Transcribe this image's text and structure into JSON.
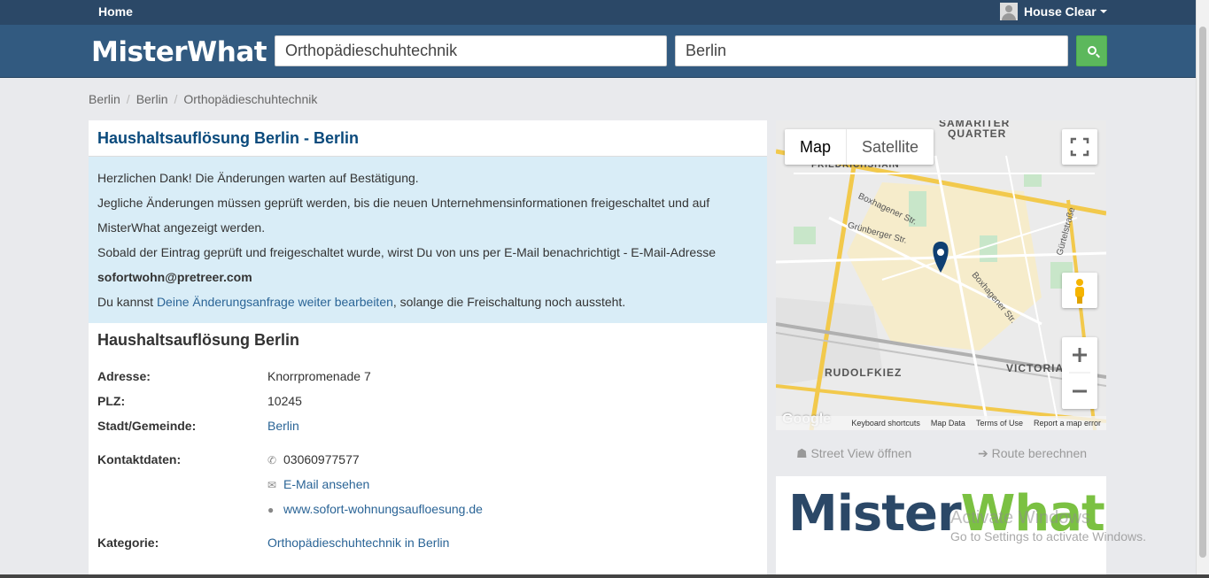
{
  "topbar": {
    "home": "Home",
    "user": "House Clear"
  },
  "header": {
    "logo": "MisterWhat",
    "what_value": "Orthopädieschuhtechnik",
    "where_value": "Berlin"
  },
  "breadcrumb": [
    "Berlin",
    "Berlin",
    "Orthopädieschuhtechnik"
  ],
  "card": {
    "title": "Haushaltsauflösung Berlin - Berlin",
    "alert": {
      "line1": "Herzlichen Dank! Die Änderungen warten auf Bestätigung.",
      "line2": "Jegliche Änderungen müssen geprüft werden, bis die neuen Unternehmensinformationen freigeschaltet und auf",
      "line3": "MisterWhat angezeigt werden.",
      "line4": "Sobald der Eintrag geprüft und freigeschaltet wurde, wirst Du von uns per E-Mail benachrichtigt - E-Mail-Adresse",
      "email": "sofortwohn@pretreer.com",
      "line6_pre": "Du kannst ",
      "line6_link": "Deine Änderungsanfrage weiter bearbeiten",
      "line6_post": ", solange die Freischaltung noch aussteht."
    },
    "name": "Haushaltsauflösung Berlin",
    "address_label": "Adresse:",
    "address": "Knorrpromenade 7",
    "plz_label": "PLZ:",
    "plz": "10245",
    "city_label": "Stadt/Gemeinde:",
    "city": "Berlin",
    "contact_label": "Kontaktdaten:",
    "phone": "03060977577",
    "email_link": "E-Mail ansehen",
    "website": "www.sofort-wohnungsaufloesung.de",
    "category_label": "Kategorie:",
    "category": "Orthopädieschuhtechnik in Berlin"
  },
  "map": {
    "tab_map": "Map",
    "tab_satellite": "Satellite",
    "labels": {
      "samariter": "SAMARITER",
      "quarter": "QUARTER",
      "friedrichshain": "FRIEDRICHSHAIN",
      "rudolfkiez": "RUDOLFKIEZ",
      "victoria": "VICTORIA",
      "boxhagener1": "Boxhagener Str.",
      "gruenberger": "Grünberger Str.",
      "boxhagener2": "Boxhagener Str.",
      "guertel": "Gürtelstraße"
    },
    "google": "Google",
    "footer": [
      "Keyboard shortcuts",
      "Map Data",
      "Terms of Use",
      "Report a map error"
    ]
  },
  "map_links": {
    "street_view": "Street View öffnen",
    "route": "Route berechnen"
  },
  "ad": {
    "logo_m": "Mister",
    "logo_w": "What"
  },
  "watermark": {
    "line1": "Activate Windows",
    "line2": "Go to Settings to activate Windows."
  }
}
